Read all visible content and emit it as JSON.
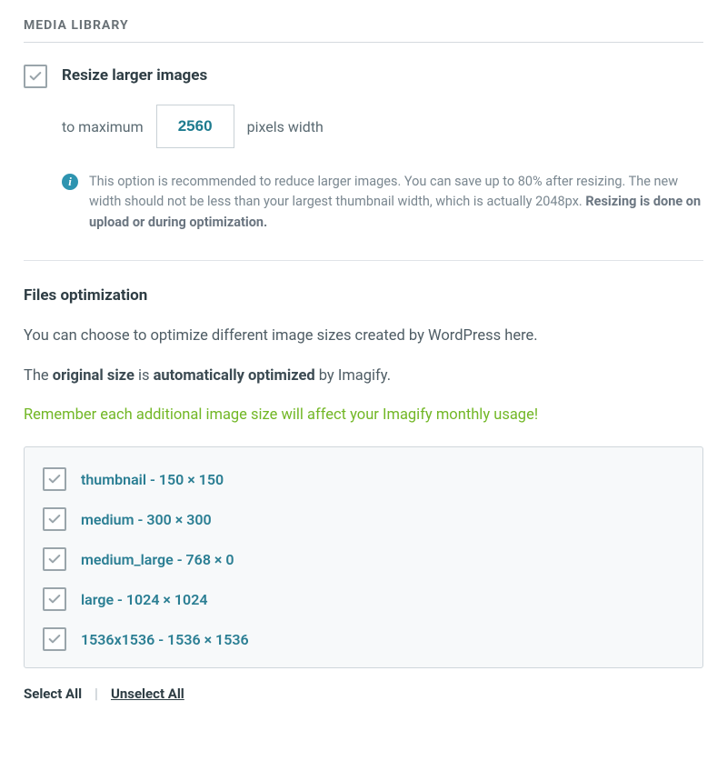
{
  "section": {
    "title": "MEDIA LIBRARY"
  },
  "resize": {
    "label": "Resize larger images",
    "prefix": "to maximum",
    "value": "2560",
    "suffix": "pixels width"
  },
  "info": {
    "text_prefix": "This option is recommended to reduce larger images. You can save up to 80% after resizing. The new width should not be less than your largest thumbnail width, which is actually 2048px. ",
    "text_bold": "Resizing is done on upload or during optimization."
  },
  "files_optimization": {
    "title": "Files optimization",
    "desc1": "You can choose to optimize different image sizes created by WordPress here.",
    "desc2_prefix": "The ",
    "desc2_b1": "original size",
    "desc2_mid": " is ",
    "desc2_b2": "automatically optimized",
    "desc2_suffix": " by Imagify.",
    "warning": "Remember each additional image size will affect your Imagify monthly usage!"
  },
  "sizes": [
    {
      "label": "thumbnail - 150 × 150"
    },
    {
      "label": "medium - 300 × 300"
    },
    {
      "label": "medium_large - 768 × 0"
    },
    {
      "label": "large - 1024 × 1024"
    },
    {
      "label": "1536x1536 - 1536 × 1536"
    }
  ],
  "bulk": {
    "select_all": "Select All",
    "unselect_all": "Unselect All"
  }
}
